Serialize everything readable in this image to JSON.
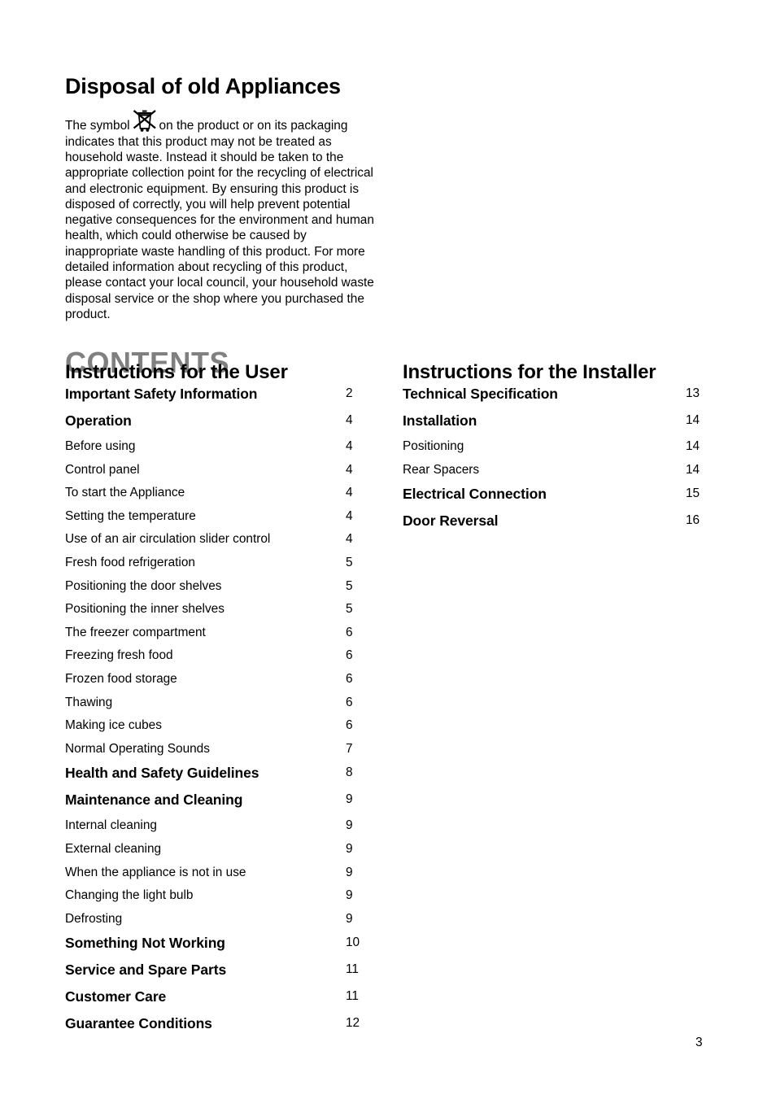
{
  "disposal": {
    "heading": "Disposal of old Appliances",
    "icon_name": "crossed-out-wheelie-bin-icon",
    "text_before_symbol": "The symbol",
    "text_after_symbol": "on the product or on its packaging indicates that this product may not be treated as household waste. Instead it should be taken to the appropriate collection point for the recycling of electrical and electronic equipment. By ensuring this product is disposed of correctly, you will help prevent potential negative consequences for the environment and human health, which could otherwise be caused by inappropriate waste handling of this product. For more detailed information about recycling of this product, please contact your local council, your household waste disposal service or the shop where you purchased the product."
  },
  "contents": {
    "title": "CONTENTS",
    "title_color": "#808080"
  },
  "left_column": {
    "heading": "Instructions for the User",
    "entries": [
      {
        "label": "Important Safety Information",
        "page": "2",
        "level": "major"
      },
      {
        "label": "Operation",
        "page": "4",
        "level": "major"
      },
      {
        "label": "Before using",
        "page": "4",
        "level": "minor"
      },
      {
        "label": "Control panel",
        "page": "4",
        "level": "minor"
      },
      {
        "label": "To start the Appliance",
        "page": "4",
        "level": "minor"
      },
      {
        "label": "Setting the temperature",
        "page": "4",
        "level": "minor"
      },
      {
        "label": "Use of an air circulation slider control",
        "page": "4",
        "level": "minor"
      },
      {
        "label": "Fresh food refrigeration",
        "page": "5",
        "level": "minor"
      },
      {
        "label": "Positioning the door shelves",
        "page": "5",
        "level": "minor"
      },
      {
        "label": "Positioning the inner shelves",
        "page": "5",
        "level": "minor"
      },
      {
        "label": "The freezer compartment",
        "page": "6",
        "level": "minor"
      },
      {
        "label": "Freezing fresh food",
        "page": "6",
        "level": "minor"
      },
      {
        "label": "Frozen food storage",
        "page": "6",
        "level": "minor"
      },
      {
        "label": "Thawing",
        "page": "6",
        "level": "minor"
      },
      {
        "label": "Making ice cubes",
        "page": "6",
        "level": "minor"
      },
      {
        "label": "Normal Operating Sounds",
        "page": "7",
        "level": "minor"
      },
      {
        "label": "Health and Safety Guidelines",
        "page": "8",
        "level": "major"
      },
      {
        "label": "Maintenance and Cleaning",
        "page": "9",
        "level": "major"
      },
      {
        "label": "Internal cleaning",
        "page": "9",
        "level": "minor"
      },
      {
        "label": "External cleaning",
        "page": "9",
        "level": "minor"
      },
      {
        "label": "When the appliance is not in use",
        "page": "9",
        "level": "minor"
      },
      {
        "label": "Changing the light bulb",
        "page": "9",
        "level": "minor"
      },
      {
        "label": "Defrosting",
        "page": "9",
        "level": "minor"
      },
      {
        "label": "Something Not Working",
        "page": "10",
        "level": "major"
      },
      {
        "label": "Service and Spare Parts",
        "page": "11",
        "level": "major"
      },
      {
        "label": "Customer Care",
        "page": "11",
        "level": "major"
      },
      {
        "label": "Guarantee Conditions",
        "page": "12",
        "level": "major"
      }
    ]
  },
  "right_column": {
    "heading": "Instructions for the Installer",
    "entries": [
      {
        "label": "Technical Specification",
        "page": "13",
        "level": "major"
      },
      {
        "label": "Installation",
        "page": "14",
        "level": "major"
      },
      {
        "label": "Positioning",
        "page": "14",
        "level": "minor"
      },
      {
        "label": "Rear Spacers",
        "page": "14",
        "level": "minor"
      },
      {
        "label": "Electrical Connection",
        "page": "15",
        "level": "major"
      },
      {
        "label": "Door Reversal",
        "page": "16",
        "level": "major"
      }
    ]
  },
  "footer": {
    "page_number": "3"
  }
}
